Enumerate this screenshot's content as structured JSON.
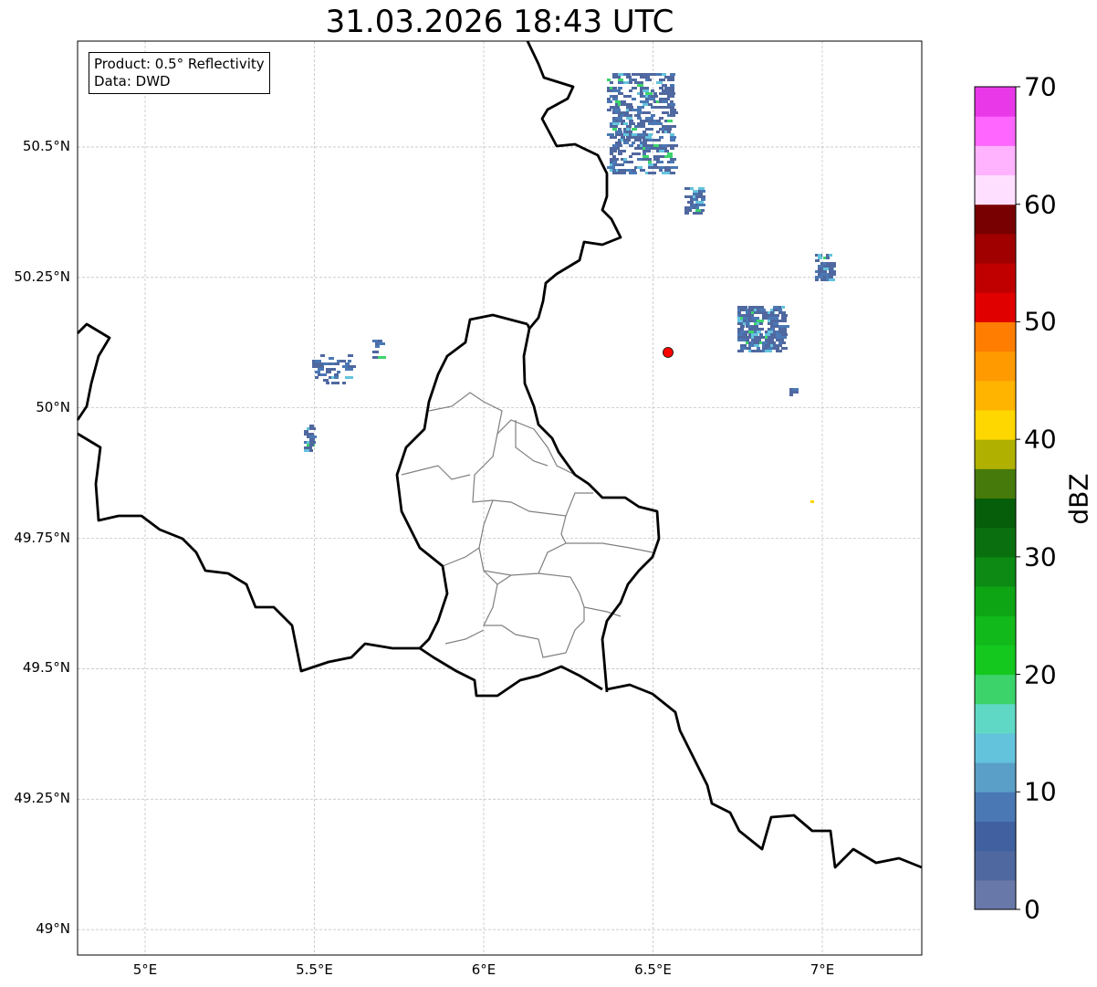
{
  "title": "31.03.2026 18:43 UTC",
  "infobox": {
    "product": "Product: 0.5° Reflectivity",
    "source": "Data: DWD"
  },
  "axes": {
    "lon_ticks": [
      {
        "value": 5.0,
        "label": "5°E"
      },
      {
        "value": 5.5,
        "label": "5.5°E"
      },
      {
        "value": 6.0,
        "label": "6°E"
      },
      {
        "value": 6.5,
        "label": "6.5°E"
      },
      {
        "value": 7.0,
        "label": "7°E"
      }
    ],
    "lat_ticks": [
      {
        "value": 50.5,
        "label": "50.5°N"
      },
      {
        "value": 50.25,
        "label": "50.25°N"
      },
      {
        "value": 50.0,
        "label": "50°N"
      },
      {
        "value": 49.75,
        "label": "49.75°N"
      },
      {
        "value": 49.5,
        "label": "49.5°N"
      },
      {
        "value": 49.25,
        "label": "49.25°N"
      },
      {
        "value": 49.0,
        "label": "49°N"
      }
    ]
  },
  "marker": {
    "label": "radar site",
    "lon": 6.55,
    "lat": 50.11,
    "color": "#ff0000"
  },
  "colorbar": {
    "label": "dBZ",
    "min": 0,
    "max": 70,
    "ticks": [
      "0",
      "10",
      "20",
      "30",
      "40",
      "50",
      "60",
      "70"
    ],
    "colors_low_to_high": [
      "#6878a8",
      "#5068a0",
      "#4060a0",
      "#4a78b4",
      "#5a9fc8",
      "#64c3dc",
      "#5fd9c6",
      "#3cd46a",
      "#14c81e",
      "#12b91a",
      "#0ea514",
      "#0c8a14",
      "#0a700f",
      "#065e0a",
      "#467a0a",
      "#b0b000",
      "#ffd700",
      "#ffb400",
      "#ff9a00",
      "#ff7d00",
      "#e00000",
      "#c00000",
      "#a00000",
      "#780000",
      "#ffdfff",
      "#ffb3ff",
      "#ff66ff",
      "#e838e8"
    ]
  }
}
